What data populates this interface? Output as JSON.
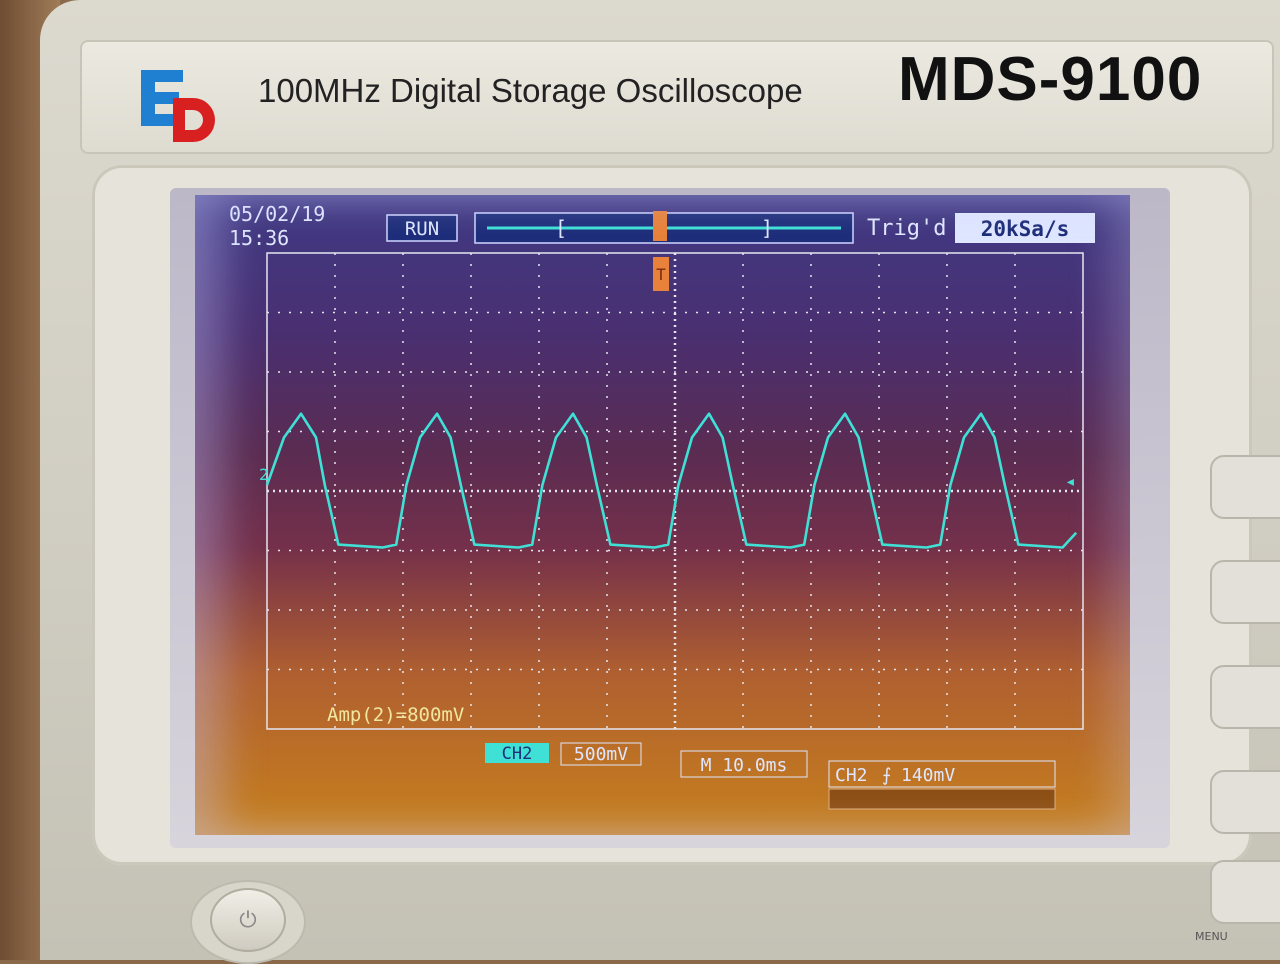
{
  "device": {
    "description": "100MHz Digital Storage Oscilloscope",
    "model": "MDS-9100",
    "menu_label": "MENU"
  },
  "status_bar": {
    "date": "05/02/19",
    "time": "15:36",
    "run_state": "RUN",
    "trigger_status": "Trig'd",
    "sample_rate": "20kSa/s",
    "trigger_marker": "T"
  },
  "channel_marker": "2",
  "measurement": "Amp(2)=800mV",
  "bottom_bar": {
    "channel": "CH2",
    "volts_per_div": "500mV",
    "timebase": "M 10.0ms",
    "trigger_source": "CH2",
    "trigger_level": "140mV"
  },
  "colors": {
    "trace": "#3fe0d6",
    "grid": "#e6e6f0",
    "status_text": "#dfe6ff",
    "trigger_marker": "#e8823a",
    "box_fill": "#1f2e7a"
  },
  "icons": {
    "logo": "ed-logo",
    "power": "power-icon",
    "trigger_edge": "rising-edge-icon"
  },
  "chart_data": {
    "type": "line",
    "x_unit": "divisions",
    "y_unit": "divisions",
    "xlim": [
      0,
      12
    ],
    "ylim": [
      -4,
      4
    ],
    "grid": true,
    "series": [
      {
        "name": "CH2",
        "x": [
          0.0,
          0.25,
          0.5,
          0.72,
          0.85,
          1.05,
          1.7,
          1.9,
          2.05,
          2.25,
          2.5,
          2.7,
          2.85,
          3.05,
          3.7,
          3.9,
          4.05,
          4.25,
          4.5,
          4.7,
          4.85,
          5.05,
          5.7,
          5.9,
          6.05,
          6.25,
          6.5,
          6.7,
          6.85,
          7.05,
          7.7,
          7.9,
          8.05,
          8.25,
          8.5,
          8.7,
          8.85,
          9.05,
          9.7,
          9.9,
          10.05,
          10.25,
          10.5,
          10.7,
          10.85,
          11.05,
          11.7,
          11.9
        ],
        "y": [
          0.1,
          0.9,
          1.3,
          0.9,
          0.1,
          -0.9,
          -0.95,
          -0.9,
          0.1,
          0.9,
          1.3,
          0.9,
          0.1,
          -0.9,
          -0.95,
          -0.9,
          0.1,
          0.9,
          1.3,
          0.9,
          0.1,
          -0.9,
          -0.95,
          -0.9,
          0.1,
          0.9,
          1.3,
          0.9,
          0.1,
          -0.9,
          -0.95,
          -0.9,
          0.1,
          0.9,
          1.3,
          0.9,
          0.1,
          -0.9,
          -0.95,
          -0.9,
          0.1,
          0.9,
          1.3,
          0.9,
          0.1,
          -0.9,
          -0.95,
          -0.7
        ]
      }
    ]
  }
}
